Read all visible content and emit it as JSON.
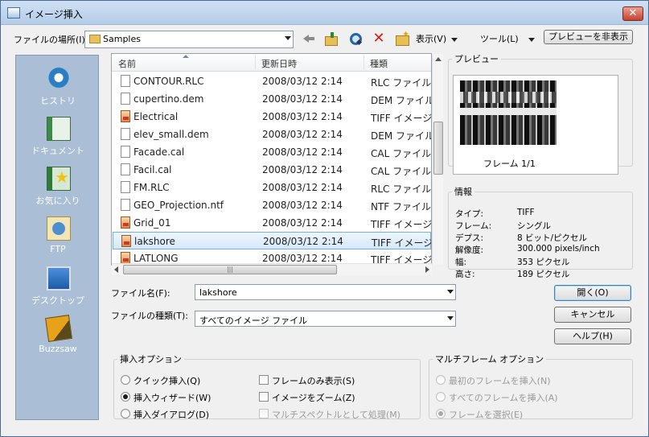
{
  "title": "イメージ挿入",
  "toolbar": {
    "lookin_label": "ファイルの場所(I):",
    "lookin_value": "Samples",
    "view_menu": "表示(V)",
    "tools_menu": "ツール(L)",
    "preview_toggle": "プレビューを非表示"
  },
  "places": [
    "ヒストリ",
    "ドキュメント",
    "お気に入り",
    "FTP",
    "デスクトップ",
    "Buzzsaw"
  ],
  "columns": [
    "名前",
    "更新日時",
    "種類"
  ],
  "files": [
    {
      "name": "CONTOUR.RLC",
      "date": "2008/03/12 2:14",
      "type": "RLC ファイル",
      "icon": "file-icon"
    },
    {
      "name": "cupertino.dem",
      "date": "2008/03/12 2:14",
      "type": "DEM ファイル",
      "icon": "file-icon"
    },
    {
      "name": "Electrical",
      "date": "2008/03/12 2:14",
      "type": "TIFF イメージ",
      "icon": "tiff-icon"
    },
    {
      "name": "elev_small.dem",
      "date": "2008/03/12 2:14",
      "type": "DEM ファイル",
      "icon": "file-icon"
    },
    {
      "name": "Facade.cal",
      "date": "2008/03/12 2:14",
      "type": "CAL ファイル",
      "icon": "file-icon"
    },
    {
      "name": "Facil.cal",
      "date": "2008/03/12 2:14",
      "type": "CAL ファイル",
      "icon": "file-icon"
    },
    {
      "name": "FM.RLC",
      "date": "2008/03/12 2:14",
      "type": "RLC ファイル",
      "icon": "file-icon"
    },
    {
      "name": "GEO_Projection.ntf",
      "date": "2008/03/12 2:14",
      "type": "NTF ファイル",
      "icon": "file-icon"
    },
    {
      "name": "Grid_01",
      "date": "2008/03/12 2:14",
      "type": "TIFF イメージ",
      "icon": "tiff-icon"
    },
    {
      "name": "lakshore",
      "date": "2008/03/12 2:14",
      "type": "TIFF イメージ",
      "icon": "tiff-icon",
      "selected": true
    },
    {
      "name": "LATLONG",
      "date": "2008/03/12 2:14",
      "type": "TIFF イメージ",
      "icon": "tiff-icon"
    }
  ],
  "preview": {
    "legend": "プレビュー",
    "frame": "フレーム 1/1"
  },
  "info": {
    "legend": "情報",
    "rows": [
      {
        "key": "タイプ:",
        "value": "TIFF"
      },
      {
        "key": "フレーム:",
        "value": "シングル"
      },
      {
        "key": "デプス:",
        "value": "8 ビット/ピクセル"
      },
      {
        "key": "解像度:",
        "value": "300.000 pixels/inch"
      },
      {
        "key": "幅:",
        "value": "353 ピクセル"
      },
      {
        "key": "高さ:",
        "value": "189 ピクセル"
      }
    ]
  },
  "filename": {
    "label": "ファイル名(F):",
    "value": "lakshore"
  },
  "filetype": {
    "label": "ファイルの種類(T):",
    "value": "すべてのイメージ ファイル"
  },
  "buttons": {
    "open": "開く(O)",
    "cancel": "キャンセル",
    "help": "ヘルプ(H)"
  },
  "insert_options": {
    "legend": "挿入オプション",
    "radios": [
      {
        "label": "クイック挿入(Q)",
        "checked": false
      },
      {
        "label": "挿入ウィザード(W)",
        "checked": true
      },
      {
        "label": "挿入ダイアログ(D)",
        "checked": false
      }
    ],
    "checks": [
      {
        "label": "フレームのみ表示(S)",
        "checked": false,
        "disabled": false
      },
      {
        "label": "イメージをズーム(Z)",
        "checked": false,
        "disabled": false
      },
      {
        "label": "マルチスペクトルとして処理(M)",
        "checked": false,
        "disabled": true
      }
    ]
  },
  "multiframe": {
    "legend": "マルチフレーム オプション",
    "radios": [
      {
        "label": "最初のフレームを挿入(N)",
        "checked": false
      },
      {
        "label": "すべてのフレームを挿入(A)",
        "checked": false
      },
      {
        "label": "フレームを選択(E)",
        "checked": true
      }
    ]
  }
}
